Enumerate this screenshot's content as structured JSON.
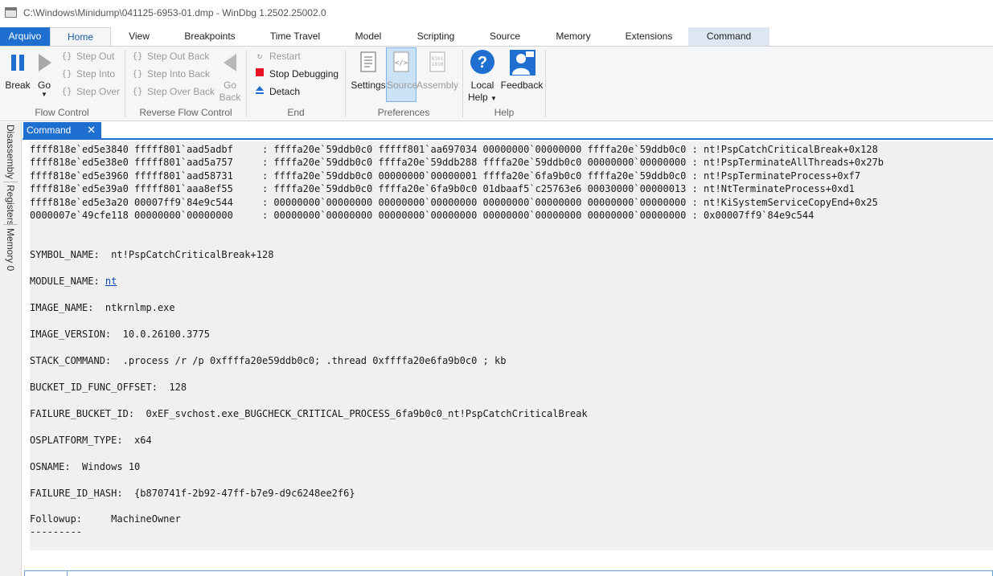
{
  "window": {
    "title": "C:\\Windows\\Minidump\\041125-6953-01.dmp - WinDbg 1.2502.25002.0"
  },
  "ribbon_tabs": [
    "Arquivo",
    "Home",
    "View",
    "Breakpoints",
    "Time Travel",
    "Model",
    "Scripting",
    "Source",
    "Memory",
    "Extensions",
    "Command"
  ],
  "flow_control": {
    "label": "Flow Control",
    "break": "Break",
    "go": "Go",
    "step_out": "Step Out",
    "step_into": "Step Into",
    "step_over": "Step Over"
  },
  "reverse_flow": {
    "label": "Reverse Flow Control",
    "step_out_back": "Step Out Back",
    "step_into_back": "Step Into Back",
    "step_over_back": "Step Over Back",
    "go_back_1": "Go",
    "go_back_2": "Back"
  },
  "end": {
    "label": "End",
    "restart": "Restart",
    "stop": "Stop Debugging",
    "detach": "Detach"
  },
  "preferences": {
    "label": "Preferences",
    "settings": "Settings",
    "source": "Source",
    "assembly": "Assembly"
  },
  "help": {
    "label": "Help",
    "local_help_1": "Local",
    "local_help_2": "Help",
    "feedback": "Feedback"
  },
  "sidebar": {
    "disassembly": "Disassembly",
    "registers": "Registers",
    "memory": "Memory 0"
  },
  "doc_tab": {
    "label": "Command",
    "close": "✕"
  },
  "output": {
    "stack_lines": [
      "ffff818e`ed5e3840 fffff801`aad5adbf     : ffffa20e`59ddb0c0 fffff801`aa697034 00000000`00000000 ffffa20e`59ddb0c0 : nt!PspCatchCriticalBreak+0x128",
      "ffff818e`ed5e38e0 fffff801`aad5a757     : ffffa20e`59ddb0c0 ffffa20e`59ddb288 ffffa20e`59ddb0c0 00000000`00000000 : nt!PspTerminateAllThreads+0x27b",
      "ffff818e`ed5e3960 fffff801`aad58731     : ffffa20e`59ddb0c0 00000000`00000001 ffffa20e`6fa9b0c0 ffffa20e`59ddb0c0 : nt!PspTerminateProcess+0xf7",
      "ffff818e`ed5e39a0 fffff801`aaa8ef55     : ffffa20e`59ddb0c0 ffffa20e`6fa9b0c0 01dbaaf5`c25763e6 00030000`00000013 : nt!NtTerminateProcess+0xd1",
      "ffff818e`ed5e3a20 00007ff9`84e9c544     : 00000000`00000000 00000000`00000000 00000000`00000000 00000000`00000000 : nt!KiSystemServiceCopyEnd+0x25",
      "0000007e`49cfe118 00000000`00000000     : 00000000`00000000 00000000`00000000 00000000`00000000 00000000`00000000 : 0x00007ff9`84e9c544"
    ],
    "symbol_name": "SYMBOL_NAME:  nt!PspCatchCriticalBreak+128",
    "module_name_label": "MODULE_NAME: ",
    "module_name_link": "nt",
    "image_name": "IMAGE_NAME:  ntkrnlmp.exe",
    "image_version": "IMAGE_VERSION:  10.0.26100.3775",
    "stack_command": "STACK_COMMAND:  .process /r /p 0xffffa20e59ddb0c0; .thread 0xffffa20e6fa9b0c0 ; kb",
    "bucket_offset": "BUCKET_ID_FUNC_OFFSET:  128",
    "failure_bucket": "FAILURE_BUCKET_ID:  0xEF_svchost.exe_BUGCHECK_CRITICAL_PROCESS_6fa9b0c0_nt!PspCatchCriticalBreak",
    "osplatform": "OSPLATFORM_TYPE:  x64",
    "osname": "OSNAME:  Windows 10",
    "failure_hash": "FAILURE_ID_HASH:  {b870741f-2b92-47ff-b7e9-d9c6248ee2f6}",
    "followup": "Followup:     MachineOwner",
    "dashes": "---------"
  },
  "colors": {
    "accent": "#1e6fd0",
    "stop_red": "#e81123",
    "link": "#0645ad"
  }
}
